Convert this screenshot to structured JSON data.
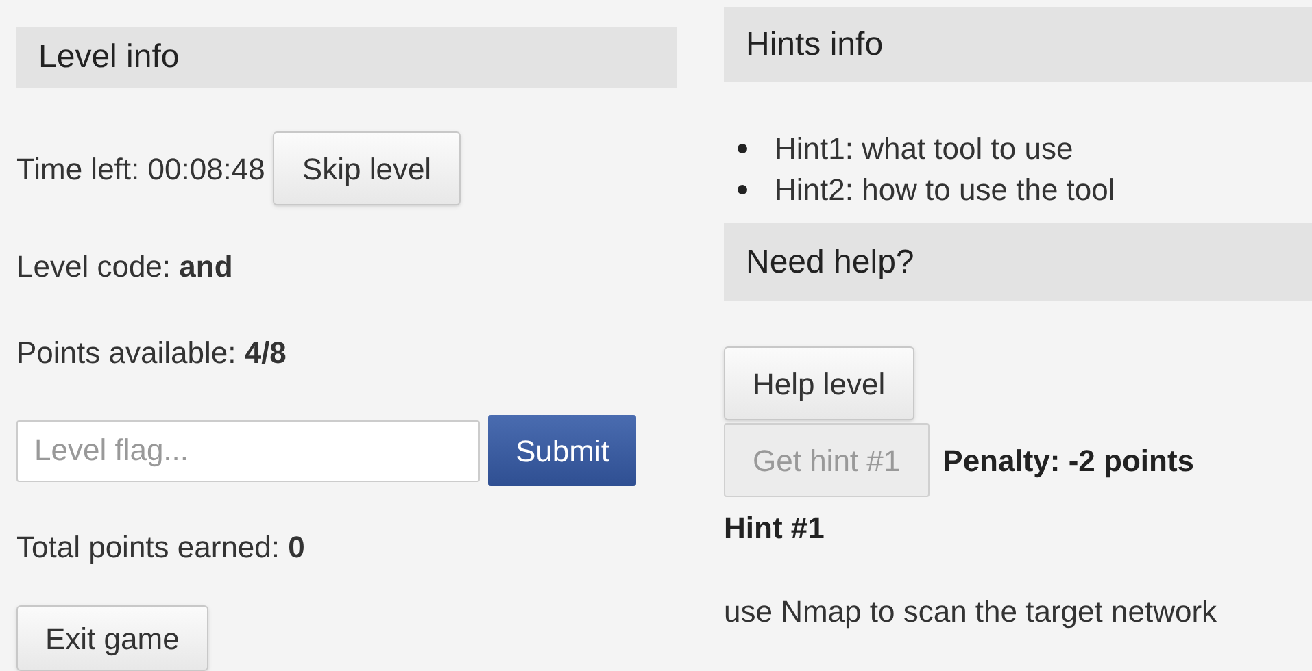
{
  "level_panel": {
    "title": "Level info",
    "time_left": "Time left: 00:08:48",
    "skip_button": "Skip level",
    "level_code": "Level code: **and**",
    "points_available": "Points available: **4/8**",
    "flag_field": {
      "placeholder": "Level flag..."
    },
    "submit_button": "Submit",
    "total_points": "Total points earned: **0**",
    "exit_button": "Exit game"
  },
  "hints_panel": {
    "title": "Hints info",
    "hints": [
      "Hint1: what tool to use",
      "Hint2: how to use the tool"
    ]
  },
  "help_panel": {
    "title": "Need help?",
    "help_button": "Help level",
    "hint_button": {
      "label": "Get hint #1",
      "disabled": true
    },
    "penalty": "Penalty: -2 points",
    "hint_title": "Hint #1",
    "hint_text": "use Nmap to scan the target network"
  }
}
